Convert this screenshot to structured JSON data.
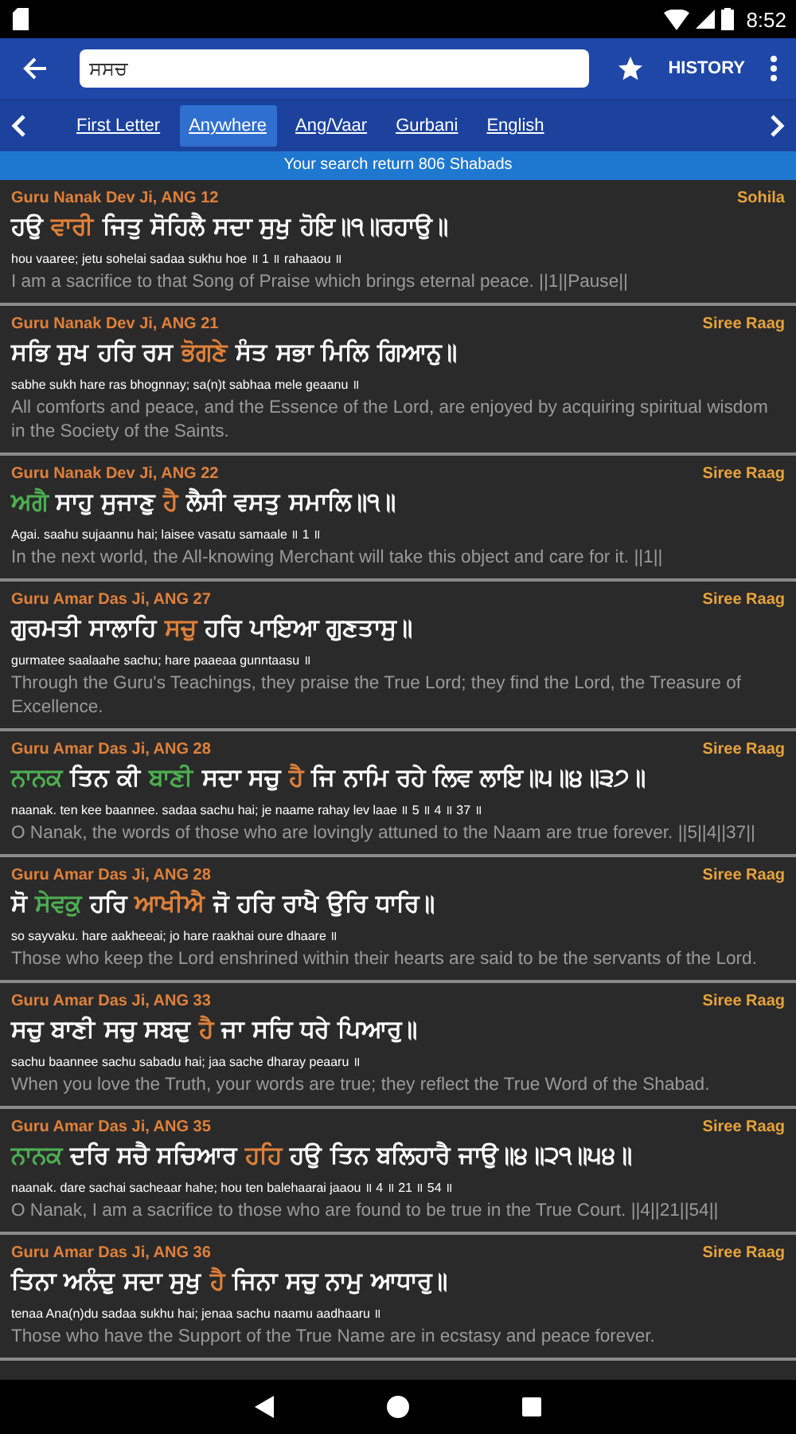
{
  "status_bar": {
    "time": "8:52"
  },
  "toolbar": {
    "search": {
      "value": "ਸਸਚ"
    },
    "history_label": "HISTORY"
  },
  "tabs": [
    {
      "label": "First Letter",
      "selected": false
    },
    {
      "label": "Anywhere",
      "selected": true
    },
    {
      "label": "Ang/Vaar",
      "selected": false
    },
    {
      "label": "Gurbani",
      "selected": false
    },
    {
      "label": "English",
      "selected": false
    }
  ],
  "result_banner": "Your search return 806 Shabads",
  "results": [
    {
      "source": "Guru Nanak Dev Ji, ANG 12",
      "raag": "Sohila",
      "gurmukhi": [
        {
          "text": "ਹਉ "
        },
        {
          "text": "ਵਾਰੀ",
          "color": "#e0803a"
        },
        {
          "text": " ਜਿਤੁ ਸੋਹਿਲੈ ਸਦਾ ਸੁਖੁ ਹੋਇ॥੧॥ਰਹਾਉ॥"
        }
      ],
      "transliteration": "hou vaaree; jetu sohelai sadaa sukhu hoe ॥ 1 ॥ rahaaou ॥",
      "translation": "I am a sacrifice to that Song of Praise which brings eternal peace. ||1||Pause||"
    },
    {
      "source": "Guru Nanak Dev Ji, ANG 21",
      "raag": "Siree Raag",
      "gurmukhi": [
        {
          "text": "ਸਭਿ ਸੁਖ ਹਰਿ ਰਸ "
        },
        {
          "text": "ਭੋਗਣੇ",
          "color": "#e0803a"
        },
        {
          "text": " ਸੰਤ ਸਭਾ ਮਿਲਿ ਗਿਆਨੁ॥"
        }
      ],
      "transliteration": "sabhe sukh hare ras bhognnay; sa(n)t sabhaa mele geaanu ॥",
      "translation": "All comforts and peace, and the Essence of the Lord, are enjoyed by acquiring spiritual wisdom in the Society of the Saints."
    },
    {
      "source": "Guru Nanak Dev Ji, ANG 22",
      "raag": "Siree Raag",
      "gurmukhi": [
        {
          "text": "ਅਗੈ",
          "color": "#4caf50"
        },
        {
          "text": " ਸਾਹੁ ਸੁਜਾਣੁ "
        },
        {
          "text": "ਹੈ",
          "color": "#e0803a"
        },
        {
          "text": " ਲੈਸੀ ਵਸਤੁ ਸਮਾਲਿ॥੧॥"
        }
      ],
      "transliteration": "Agai. saahu sujaannu hai; laisee vasatu samaale ॥ 1 ॥",
      "translation": "In the next world, the All-knowing Merchant will take this object and care for it. ||1||"
    },
    {
      "source": "Guru Amar Das Ji, ANG 27",
      "raag": "Siree Raag",
      "gurmukhi": [
        {
          "text": "ਗੁਰਮਤੀ ਸਾਲਾਹਿ "
        },
        {
          "text": "ਸਚੁ",
          "color": "#e0803a"
        },
        {
          "text": " ਹਰਿ ਪਾਇਆ ਗੁਣਤਾਸੁ॥"
        }
      ],
      "transliteration": "gurmatee saalaahe sachu; hare paaeaa gunntaasu ॥",
      "translation": "Through the Guru's Teachings, they praise the True Lord; they find the Lord, the Treasure of Excellence."
    },
    {
      "source": "Guru Amar Das Ji, ANG 28",
      "raag": "Siree Raag",
      "gurmukhi": [
        {
          "text": "ਨਾਨਕ",
          "color": "#4caf50"
        },
        {
          "text": " ਤਿਨ ਕੀ "
        },
        {
          "text": "ਬਾਣੀ",
          "color": "#4caf50"
        },
        {
          "text": " ਸਦਾ ਸਚੁ "
        },
        {
          "text": "ਹੈ",
          "color": "#e0803a"
        },
        {
          "text": " ਜਿ ਨਾਮਿ ਰਹੇ ਲਿਵ ਲਾਇ॥੫॥੪॥੩੭॥"
        }
      ],
      "transliteration": "naanak. ten kee baannee. sadaa sachu hai; je naame rahay lev laae ॥ 5 ॥ 4 ॥ 37 ॥",
      "translation": "O Nanak, the words of those who are lovingly attuned to the Naam are true forever. ||5||4||37||"
    },
    {
      "source": "Guru Amar Das Ji, ANG 28",
      "raag": "Siree Raag",
      "gurmukhi": [
        {
          "text": "ਸੋ "
        },
        {
          "text": "ਸੇਵਕੁ",
          "color": "#4caf50"
        },
        {
          "text": " ਹਰਿ "
        },
        {
          "text": "ਆਖੀਐ",
          "color": "#e0803a"
        },
        {
          "text": " ਜੋ ਹਰਿ ਰਾਖੈ ਉਰਿ ਧਾਰਿ॥"
        }
      ],
      "transliteration": "so sayvaku. hare aakheeai; jo hare raakhai oure dhaare ॥",
      "translation": "Those who keep the Lord enshrined within their hearts are said to be the servants of the Lord."
    },
    {
      "source": "Guru Amar Das Ji, ANG 33",
      "raag": "Siree Raag",
      "gurmukhi": [
        {
          "text": "ਸਚੁ ਬਾਣੀ ਸਚੁ ਸਬਦੁ "
        },
        {
          "text": "ਹੈ",
          "color": "#e0803a"
        },
        {
          "text": " ਜਾ ਸਚਿ ਧਰੇ ਪਿਆਰੁ॥"
        }
      ],
      "transliteration": "sachu baannee sachu sabadu hai; jaa sache dharay peaaru ॥",
      "translation": "When you love the Truth, your words are true; they reflect the True Word of the Shabad."
    },
    {
      "source": "Guru Amar Das Ji, ANG 35",
      "raag": "Siree Raag",
      "gurmukhi": [
        {
          "text": "ਨਾਨਕ",
          "color": "#4caf50"
        },
        {
          "text": " ਦਰਿ ਸਚੈ ਸਚਿਆਰ "
        },
        {
          "text": "ਹਹਿ",
          "color": "#e0803a"
        },
        {
          "text": " ਹਉ ਤਿਨ ਬਲਿਹਾਰੈ ਜਾਉ॥੪॥੨੧॥੫੪॥"
        }
      ],
      "transliteration": "naanak. dare sachai sacheaar hahe; hou ten balehaarai jaaou ॥ 4 ॥ 21 ॥ 54 ॥",
      "translation": "O Nanak, I am a sacrifice to those who are found to be true in the True Court. ||4||21||54||"
    },
    {
      "source": "Guru Amar Das Ji, ANG 36",
      "raag": "Siree Raag",
      "gurmukhi": [
        {
          "text": "ਤਿਨਾ ਅਨੰਦੁ ਸਦਾ ਸੁਖੁ "
        },
        {
          "text": "ਹੈ",
          "color": "#e0803a"
        },
        {
          "text": " ਜਿਨਾ ਸਚੁ ਨਾਮੁ ਆਧਾਰੁ॥"
        }
      ],
      "transliteration": "tenaa Ana(n)du sadaa sukhu hai; jenaa sachu naamu aadhaaru ॥",
      "translation": "Those who have the Support of the True Name are in ecstasy and peace forever."
    }
  ]
}
